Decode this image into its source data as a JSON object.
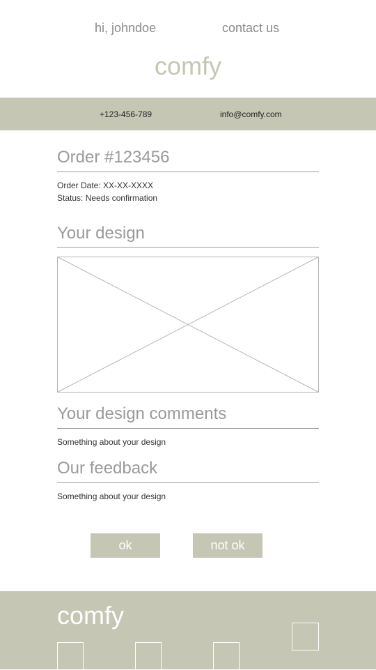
{
  "header": {
    "greeting": "hi, johndoe",
    "contact_label": "contact us",
    "brand": "comfy"
  },
  "infobar": {
    "phone": "+123-456-789",
    "email": "info@comfy.com"
  },
  "order": {
    "title": "Order #123456",
    "date_line": "Order Date: XX-XX-XXXX",
    "status_line": "Status: Needs confirmation"
  },
  "design": {
    "title": "Your design"
  },
  "comments": {
    "title": "Your design comments",
    "text": "Something about your design"
  },
  "feedback": {
    "title": "Our feedback",
    "text": "Something about your design"
  },
  "actions": {
    "ok_label": "ok",
    "not_ok_label": "not ok"
  },
  "footer": {
    "brand": "comfy"
  },
  "colors": {
    "accent": "#c5c6b3",
    "heading_text": "#9a9a9a",
    "body_text": "#333333"
  }
}
